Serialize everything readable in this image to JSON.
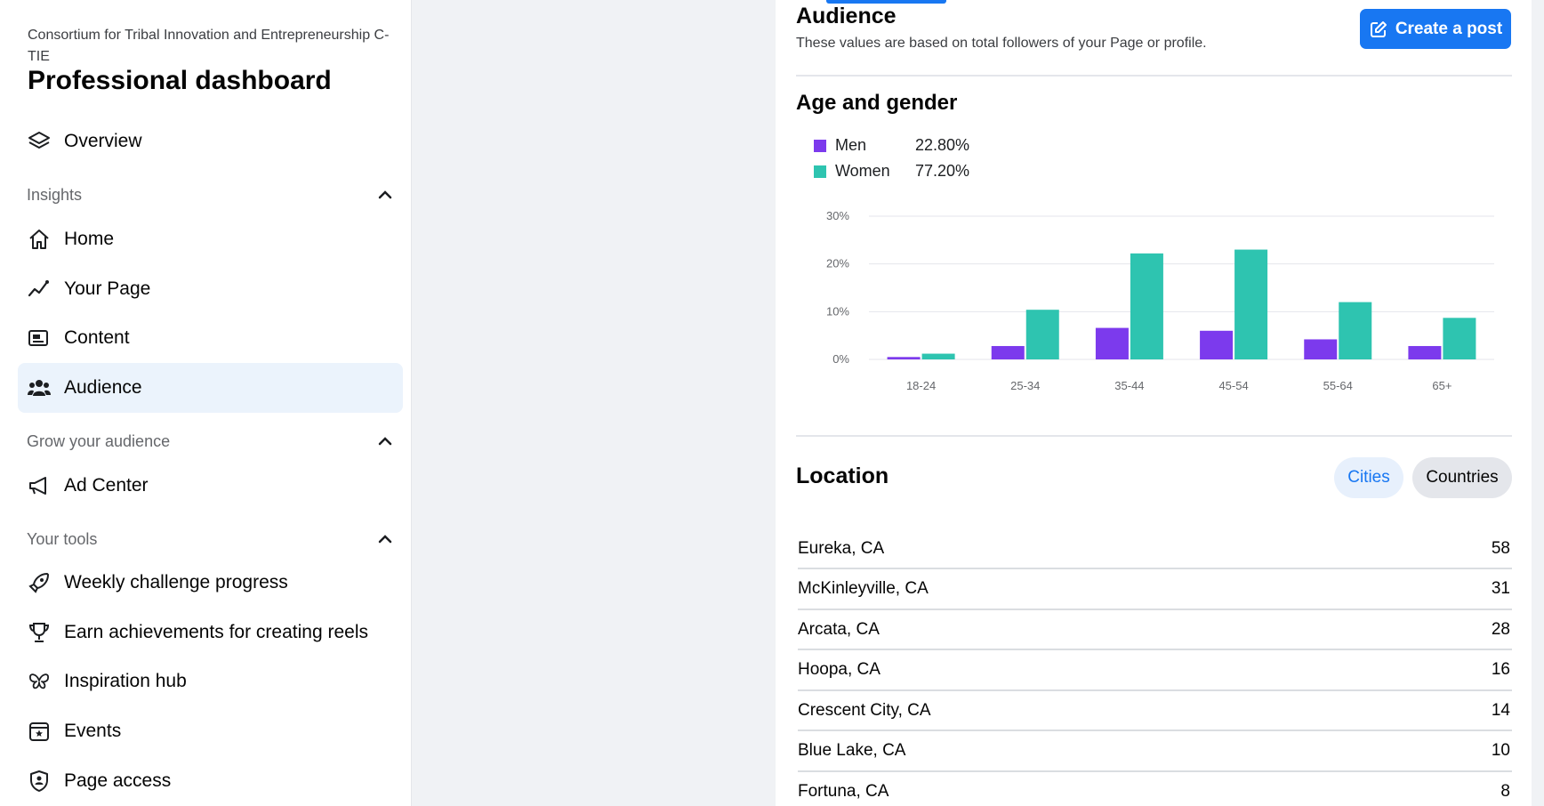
{
  "sidebar": {
    "org_name": "Consortium for Tribal Innovation and Entrepreneurship C-TIE",
    "title": "Professional dashboard",
    "overview": "Overview",
    "insights_header": "Insights",
    "insights_items": [
      "Home",
      "Your Page",
      "Content",
      "Audience"
    ],
    "grow_header": "Grow your audience",
    "grow_items": [
      "Ad Center"
    ],
    "tools_header": "Your tools",
    "tools_items": [
      "Weekly challenge progress",
      "Earn achievements for creating reels",
      "Inspiration hub",
      "Events",
      "Page access"
    ],
    "active_item": "Audience"
  },
  "audience": {
    "title": "Audience",
    "subtitle": "These values are based on total followers of your Page or profile.",
    "create_post": "Create a post"
  },
  "age_gender": {
    "title": "Age and gender",
    "legend": [
      {
        "name": "Men",
        "value": "22.80%"
      },
      {
        "name": "Women",
        "value": "77.20%"
      }
    ]
  },
  "chart_data": {
    "type": "bar",
    "title": "Age and gender",
    "categories": [
      "18-24",
      "25-34",
      "35-44",
      "45-54",
      "55-64",
      "65+"
    ],
    "series": [
      {
        "name": "Men",
        "values": [
          0.5,
          2.8,
          6.6,
          6.0,
          4.2,
          2.8
        ],
        "color": "#7c3aed"
      },
      {
        "name": "Women",
        "values": [
          1.2,
          10.4,
          22.2,
          23.0,
          12.0,
          8.7
        ],
        "color": "#2ec4b0"
      }
    ],
    "yticks": [
      "0%",
      "10%",
      "20%",
      "30%"
    ],
    "ylim": [
      0,
      30
    ],
    "grid": true
  },
  "location": {
    "title": "Location",
    "tabs": {
      "cities": "Cities",
      "countries": "Countries"
    },
    "active_tab": "Cities",
    "rows": [
      {
        "city": "Eureka, CA",
        "count": "58"
      },
      {
        "city": "McKinleyville, CA",
        "count": "31"
      },
      {
        "city": "Arcata, CA",
        "count": "28"
      },
      {
        "city": "Hoopa, CA",
        "count": "16"
      },
      {
        "city": "Crescent City, CA",
        "count": "14"
      },
      {
        "city": "Blue Lake, CA",
        "count": "10"
      },
      {
        "city": "Fortuna, CA",
        "count": "8"
      }
    ]
  }
}
